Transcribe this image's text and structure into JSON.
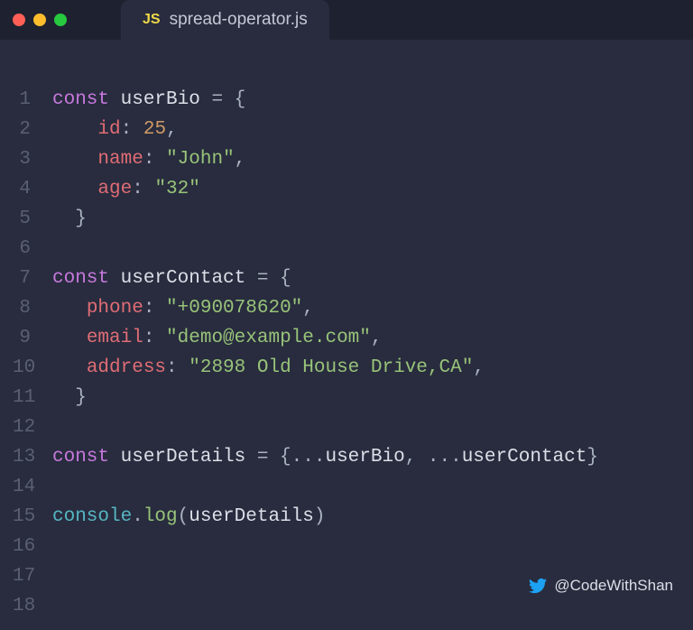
{
  "tab": {
    "icon_label": "JS",
    "filename": "spread-operator.js"
  },
  "code_lines": [
    {
      "n": "1",
      "tokens": [
        [
          "kw",
          "const"
        ],
        [
          "punct",
          " "
        ],
        [
          "var",
          "userBio"
        ],
        [
          "punct",
          " = {"
        ]
      ]
    },
    {
      "n": "2",
      "tokens": [
        [
          "punct",
          "    "
        ],
        [
          "prop",
          "id"
        ],
        [
          "punct",
          ": "
        ],
        [
          "num",
          "25"
        ],
        [
          "punct",
          ","
        ]
      ]
    },
    {
      "n": "3",
      "tokens": [
        [
          "punct",
          "    "
        ],
        [
          "prop",
          "name"
        ],
        [
          "punct",
          ": "
        ],
        [
          "str",
          "\"John\""
        ],
        [
          "punct",
          ","
        ]
      ]
    },
    {
      "n": "4",
      "tokens": [
        [
          "punct",
          "    "
        ],
        [
          "prop",
          "age"
        ],
        [
          "punct",
          ": "
        ],
        [
          "str",
          "\"32\""
        ]
      ]
    },
    {
      "n": "5",
      "tokens": [
        [
          "punct",
          "  }"
        ]
      ]
    },
    {
      "n": "6",
      "tokens": []
    },
    {
      "n": "7",
      "tokens": [
        [
          "kw",
          "const"
        ],
        [
          "punct",
          " "
        ],
        [
          "var",
          "userContact"
        ],
        [
          "punct",
          " = {"
        ]
      ]
    },
    {
      "n": "8",
      "tokens": [
        [
          "punct",
          "   "
        ],
        [
          "prop",
          "phone"
        ],
        [
          "punct",
          ": "
        ],
        [
          "str",
          "\"+090078620\""
        ],
        [
          "punct",
          ","
        ]
      ]
    },
    {
      "n": "9",
      "tokens": [
        [
          "punct",
          "   "
        ],
        [
          "prop",
          "email"
        ],
        [
          "punct",
          ": "
        ],
        [
          "str",
          "\"demo@example.com\""
        ],
        [
          "punct",
          ","
        ]
      ]
    },
    {
      "n": "10",
      "tokens": [
        [
          "punct",
          "   "
        ],
        [
          "prop",
          "address"
        ],
        [
          "punct",
          ": "
        ],
        [
          "str",
          "\"2898 Old House Drive,CA\""
        ],
        [
          "punct",
          ","
        ]
      ]
    },
    {
      "n": "11",
      "tokens": [
        [
          "punct",
          "  }"
        ]
      ]
    },
    {
      "n": "12",
      "tokens": []
    },
    {
      "n": "13",
      "tokens": [
        [
          "kw",
          "const"
        ],
        [
          "punct",
          " "
        ],
        [
          "var",
          "userDetails"
        ],
        [
          "punct",
          " = {..."
        ],
        [
          "var",
          "userBio"
        ],
        [
          "punct",
          ", ..."
        ],
        [
          "var",
          "userContact"
        ],
        [
          "punct",
          "}"
        ]
      ]
    },
    {
      "n": "14",
      "tokens": []
    },
    {
      "n": "15",
      "tokens": [
        [
          "obj",
          "console"
        ],
        [
          "punct",
          "."
        ],
        [
          "fn",
          "log"
        ],
        [
          "punct",
          "("
        ],
        [
          "var",
          "userDetails"
        ],
        [
          "punct",
          ")"
        ]
      ]
    },
    {
      "n": "16",
      "tokens": []
    },
    {
      "n": "17",
      "tokens": []
    },
    {
      "n": "18",
      "tokens": []
    }
  ],
  "footer": {
    "handle": "@CodeWithShan"
  }
}
